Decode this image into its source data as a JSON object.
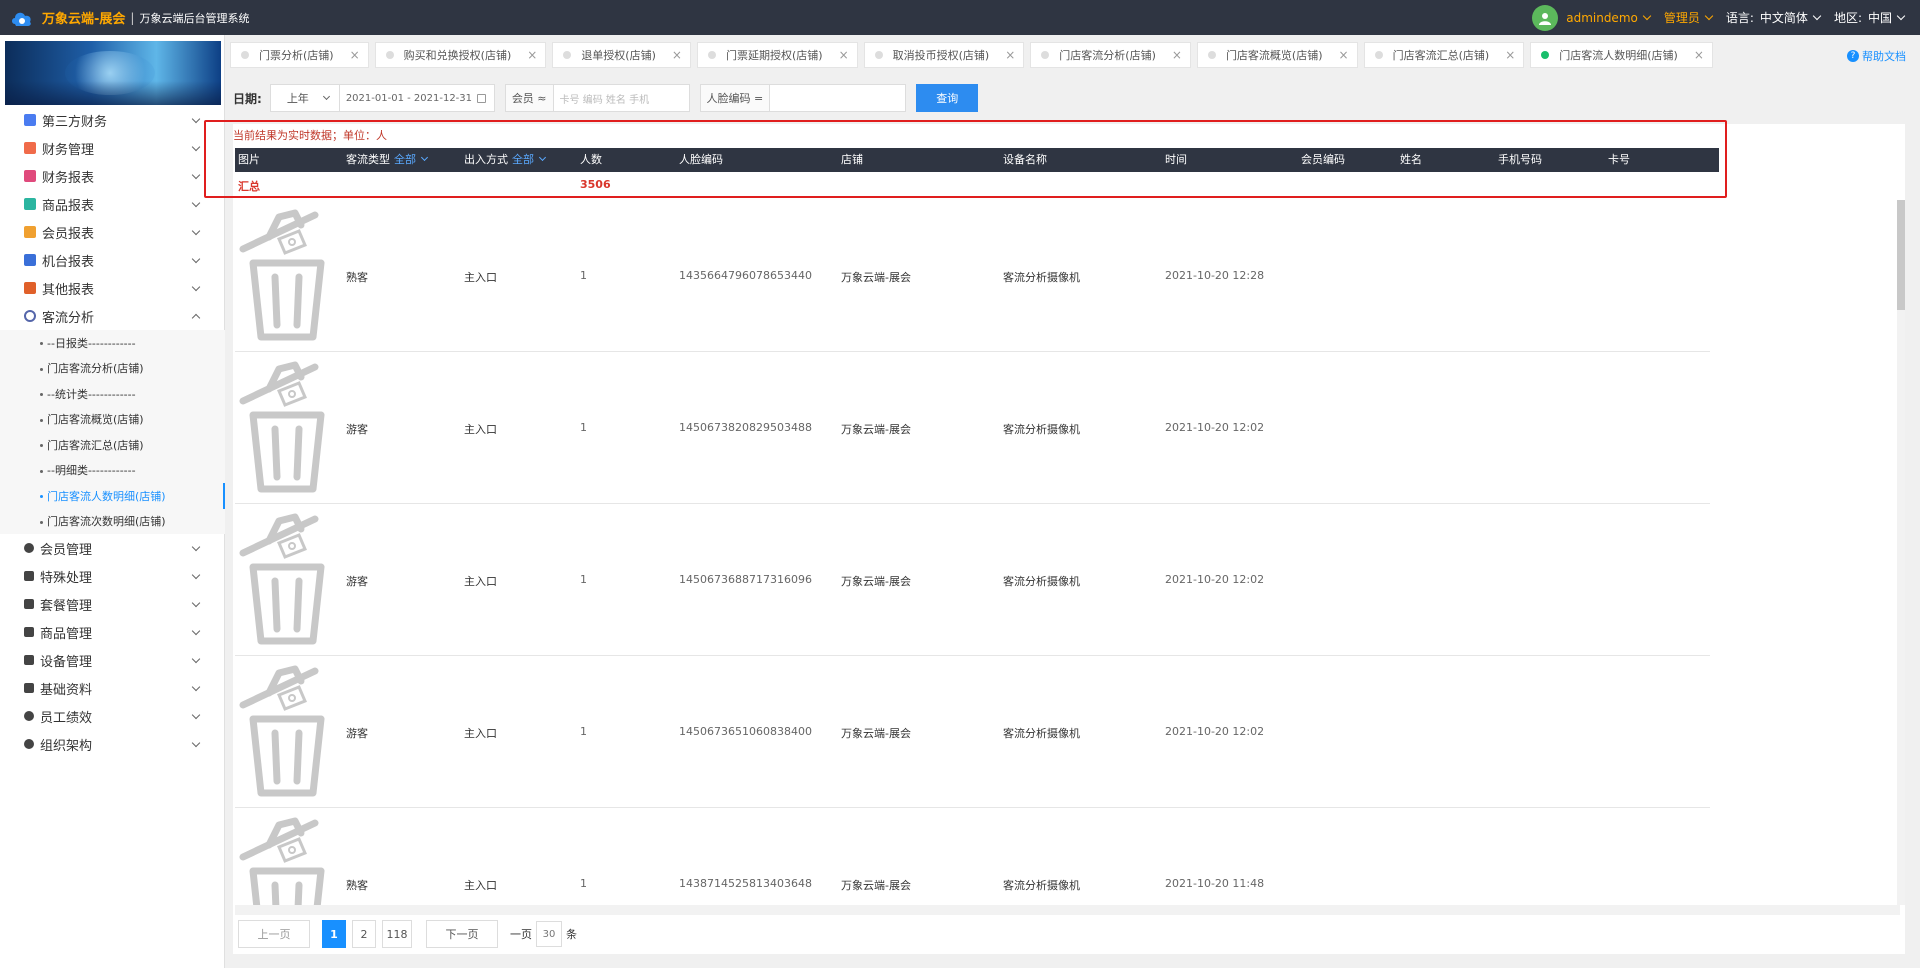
{
  "topbar": {
    "brand_name": "万象云端-展会",
    "separator": "|",
    "system_name": "万象云端后台管理系统",
    "user_name": "admindemo",
    "role": "管理员",
    "language_label": "语言:",
    "language_value": "中文简体",
    "region_label": "地区:",
    "region_value": "中国",
    "brand_color": "#ffa800"
  },
  "sidebar": {
    "menu_top": [
      {
        "label": "第三方财务",
        "icon": "finance-book-icon",
        "color": "#4a7cf0"
      },
      {
        "label": "财务管理",
        "icon": "ledger-icon",
        "color": "#f06b4a"
      },
      {
        "label": "财务报表",
        "icon": "report-icon",
        "color": "#e04a7c"
      },
      {
        "label": "商品报表",
        "icon": "goods-report-icon",
        "color": "#2bb5a0"
      },
      {
        "label": "会员报表",
        "icon": "member-report-icon",
        "color": "#f0a030"
      },
      {
        "label": "机台报表",
        "icon": "machine-report-icon",
        "color": "#3a6fd8"
      },
      {
        "label": "其他报表",
        "icon": "layers-icon",
        "color": "#e0602a"
      },
      {
        "label": "客流分析",
        "icon": "target-icon",
        "color": "#5566aa"
      }
    ],
    "submenu": [
      "--日报类------------",
      "门店客流分析(店铺)",
      "--统计类------------",
      "门店客流概览(店铺)",
      "门店客流汇总(店铺)",
      "--明细类------------",
      "门店客流人数明细(店铺)",
      "门店客流次数明细(店铺)"
    ],
    "menu_bottom": [
      {
        "label": "会员管理",
        "icon": "user-icon"
      },
      {
        "label": "特殊处理",
        "icon": "warning-icon"
      },
      {
        "label": "套餐管理",
        "icon": "edit-icon"
      },
      {
        "label": "商品管理",
        "icon": "swap-icon"
      },
      {
        "label": "设备管理",
        "icon": "device-icon"
      },
      {
        "label": "基础资料",
        "icon": "file-icon"
      },
      {
        "label": "员工绩效",
        "icon": "gear-icon"
      },
      {
        "label": "组织架构",
        "icon": "org-icon"
      }
    ]
  },
  "tabs": [
    {
      "label": "门票分析(店铺)",
      "active": false
    },
    {
      "label": "购买和兑换授权(店铺)",
      "active": false
    },
    {
      "label": "退单授权(店铺)",
      "active": false
    },
    {
      "label": "门票延期授权(店铺)",
      "active": false
    },
    {
      "label": "取消投币授权(店铺)",
      "active": false
    },
    {
      "label": "门店客流分析(店铺)",
      "active": false
    },
    {
      "label": "门店客流概览(店铺)",
      "active": false
    },
    {
      "label": "门店客流汇总(店铺)",
      "active": false
    },
    {
      "label": "门店客流人数明细(店铺)",
      "active": true
    }
  ],
  "help_label": "帮助文档",
  "filter": {
    "date_label": "日期:",
    "period_value": "上年",
    "date_range": "2021-01-01 - 2021-12-31",
    "member_label": "会员",
    "member_placeholder": "卡号 编码 姓名 手机",
    "face_label": "人脸编码",
    "face_placeholder": "",
    "query_button": "查询"
  },
  "note": "当前结果为实时数据；单位：人",
  "table": {
    "headers": {
      "picture": "图片",
      "type": "客流类型",
      "type_filter": "全部",
      "direction": "出入方式",
      "direction_filter": "全部",
      "count": "人数",
      "face_code": "人脸编码",
      "store": "店铺",
      "device": "设备名称",
      "time": "时间",
      "member_code": "会员编码",
      "name": "姓名",
      "phone": "手机号码",
      "card": "卡号"
    },
    "summary": {
      "label": "汇总",
      "count": "3506"
    },
    "rows": [
      {
        "type": "熟客",
        "direction": "主入口",
        "count": "1",
        "face_code": "1435664796078653440",
        "store": "万象云端-展会",
        "device": "客流分析摄像机",
        "time": "2021-10-20 12:28"
      },
      {
        "type": "游客",
        "direction": "主入口",
        "count": "1",
        "face_code": "1450673820829503488",
        "store": "万象云端-展会",
        "device": "客流分析摄像机",
        "time": "2021-10-20 12:02"
      },
      {
        "type": "游客",
        "direction": "主入口",
        "count": "1",
        "face_code": "1450673688717316096",
        "store": "万象云端-展会",
        "device": "客流分析摄像机",
        "time": "2021-10-20 12:02"
      },
      {
        "type": "游客",
        "direction": "主入口",
        "count": "1",
        "face_code": "1450673651060838400",
        "store": "万象云端-展会",
        "device": "客流分析摄像机",
        "time": "2021-10-20 12:02"
      },
      {
        "type": "熟客",
        "direction": "主入口",
        "count": "1",
        "face_code": "1438714525813403648",
        "store": "万象云端-展会",
        "device": "客流分析摄像机",
        "time": "2021-10-20 11:48"
      }
    ]
  },
  "pagination": {
    "prev": "上一页",
    "pages": [
      "1",
      "2",
      "118"
    ],
    "current": "1",
    "next": "下一页",
    "per_page_label": "一页",
    "per_page_value": "30",
    "per_page_unit": "条"
  }
}
